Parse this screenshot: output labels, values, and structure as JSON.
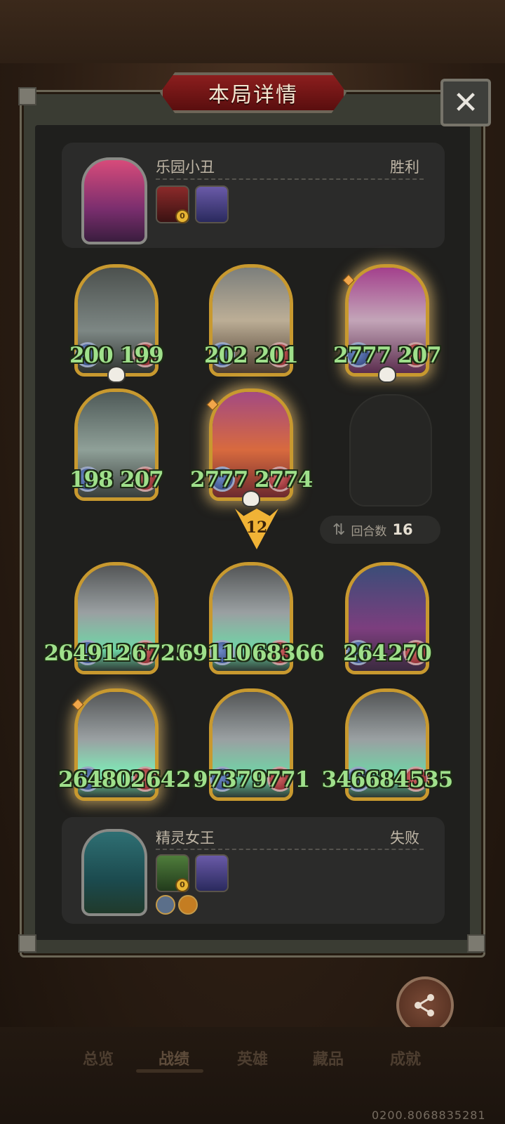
{
  "title": "本局详情",
  "close_label": "✕",
  "top_player": {
    "name": "乐园小丑",
    "result": "胜利",
    "coin_value": "0"
  },
  "bottom_player": {
    "name": "精灵女王",
    "result": "失败",
    "coin_value": "0"
  },
  "round": {
    "label": "回合数",
    "value": "16"
  },
  "tier_marker": "12",
  "top_minions": [
    {
      "attack": "200",
      "health": "199",
      "skull": true,
      "golden": false,
      "art": "robot-icon"
    },
    {
      "attack": "202",
      "health": "201",
      "skull": false,
      "golden": false,
      "art": "zeppelin-icon"
    },
    {
      "attack": "2777",
      "health": "207",
      "skull": true,
      "golden": true,
      "art": "zeppelin-icon"
    },
    {
      "attack": "198",
      "health": "207",
      "skull": false,
      "golden": false,
      "art": "shark-monster-icon"
    },
    {
      "attack": "2777",
      "health": "2774",
      "skull": true,
      "golden": true,
      "art": "red-dragon-icon"
    }
  ],
  "bottom_minions": [
    {
      "attack": "264912",
      "health": "6725",
      "golden": false,
      "art": "gray-dragon-icon"
    },
    {
      "attack": "69110",
      "health": "68366",
      "golden": false,
      "art": "gray-dragon-icon"
    },
    {
      "attack": "264",
      "health": "270",
      "golden": false,
      "art": "elf-queen-minion-icon"
    },
    {
      "attack": "264802",
      "health": "64",
      "health_tail": "21",
      "golden": true,
      "art": "gray-dragon-icon"
    },
    {
      "attack": "9737",
      "health": "9771",
      "golden": false,
      "art": "gray-dragon-icon"
    },
    {
      "attack": "346684",
      "health": "535",
      "golden": false,
      "art": "gray-dragon-icon"
    }
  ],
  "share_label": "分享",
  "tabs": [
    "总览",
    "战绩",
    "英雄",
    "藏品",
    "成就"
  ],
  "active_tab": "战绩",
  "version": "0200.8068835281"
}
